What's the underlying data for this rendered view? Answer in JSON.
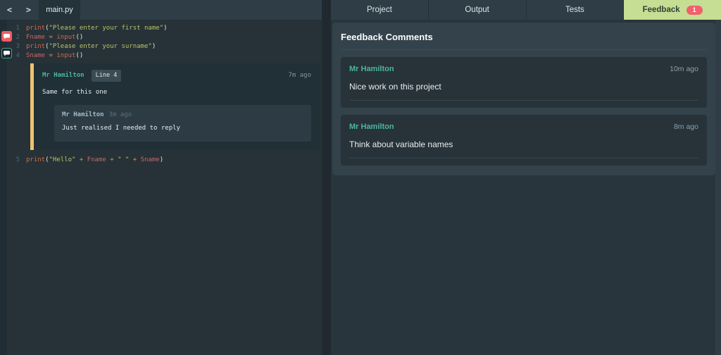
{
  "colors": {
    "accent_lime": "#c5de93",
    "badge_red": "#f2606b",
    "author_teal": "#4db6a0",
    "thread_bar_amber": "#eec36e"
  },
  "editor": {
    "nav_back": "<",
    "nav_forward": ">",
    "tab_title": "main.py",
    "lines": [
      {
        "num": "1",
        "tokens": [
          {
            "c": "fn",
            "t": "print"
          },
          {
            "c": "pu",
            "t": "("
          },
          {
            "c": "st",
            "t": "\"Please enter your first name\""
          },
          {
            "c": "pu",
            "t": ")"
          }
        ]
      },
      {
        "num": "2",
        "tokens": [
          {
            "c": "va",
            "t": "Fname"
          },
          {
            "c": "op",
            "t": " = "
          },
          {
            "c": "fn",
            "t": "input"
          },
          {
            "c": "pu",
            "t": "()"
          }
        ]
      },
      {
        "num": "3",
        "tokens": [
          {
            "c": "fn",
            "t": "print"
          },
          {
            "c": "pu",
            "t": "("
          },
          {
            "c": "st",
            "t": "\"Please enter your surname\""
          },
          {
            "c": "pu",
            "t": ")"
          }
        ]
      },
      {
        "num": "4",
        "tokens": [
          {
            "c": "va",
            "t": "Sname"
          },
          {
            "c": "op",
            "t": " = "
          },
          {
            "c": "fn",
            "t": "input"
          },
          {
            "c": "pu",
            "t": "()"
          }
        ]
      },
      {
        "num": "5",
        "tokens": [
          {
            "c": "fn",
            "t": "print"
          },
          {
            "c": "pu",
            "t": "("
          },
          {
            "c": "st",
            "t": "\"Hello\""
          },
          {
            "c": "op",
            "t": " + "
          },
          {
            "c": "va",
            "t": "Fname"
          },
          {
            "c": "op",
            "t": " + "
          },
          {
            "c": "st",
            "t": "\" \""
          },
          {
            "c": "op",
            "t": " + "
          },
          {
            "c": "va",
            "t": "Sname"
          },
          {
            "c": "pu",
            "t": ")"
          }
        ]
      }
    ],
    "markers": [
      {
        "name": "comment-marker-line-2",
        "style": "red"
      },
      {
        "name": "comment-marker-line-4",
        "style": "teal"
      }
    ]
  },
  "thread": {
    "author": "Mr Hamilton",
    "line_badge": "Line 4",
    "time": "7m ago",
    "body": "Same for this one",
    "reply": {
      "author": "Mr Hamilton",
      "time": "3m ago",
      "body": "Just realised I needed to reply"
    }
  },
  "right": {
    "tabs": [
      {
        "label": "Project"
      },
      {
        "label": "Output"
      },
      {
        "label": "Tests"
      },
      {
        "label": "Feedback",
        "badge": "1"
      }
    ],
    "panel": {
      "title": "Feedback Comments",
      "comments": [
        {
          "author": "Mr Hamilton",
          "time": "10m ago",
          "body": "Nice work on this project"
        },
        {
          "author": "Mr Hamilton",
          "time": "8m ago",
          "body": "Think about variable names"
        }
      ]
    }
  }
}
